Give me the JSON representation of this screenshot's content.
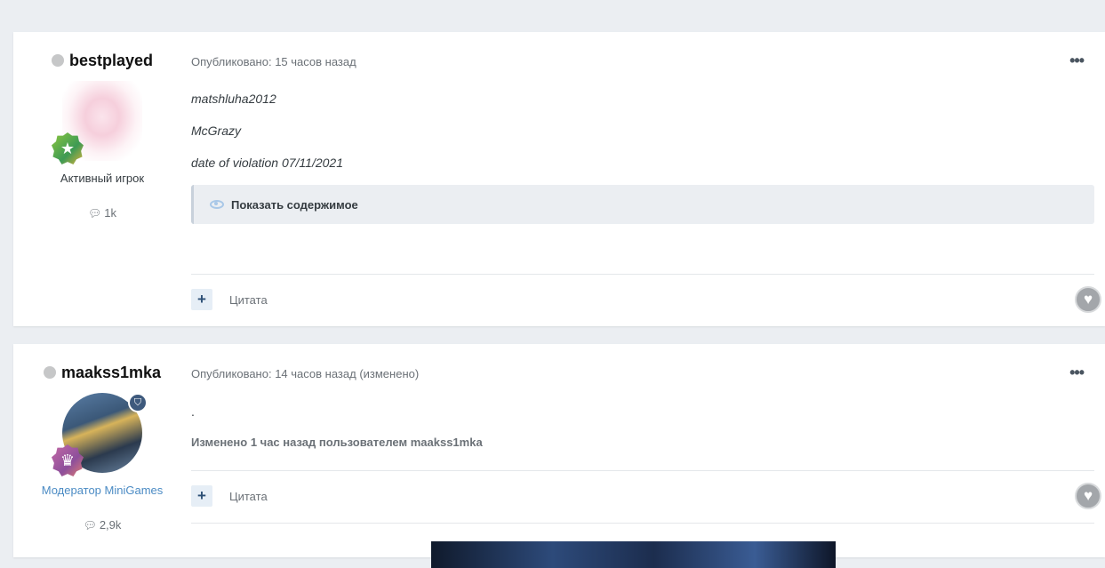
{
  "posts": [
    {
      "author": "bestplayed",
      "group": "Активный игрок",
      "post_count": "1k",
      "meta": "Опубликовано: 15 часов назад",
      "lines": [
        "matshluha2012",
        "McGrazy",
        "date of violation 07/11/2021"
      ],
      "spoiler_label": "Показать содержимое",
      "quote_label": "Цитата"
    },
    {
      "author": "maakss1mka",
      "group": "Модератор MiniGames",
      "post_count": "2,9k",
      "meta": "Опубликовано: 14 часов назад (изменено)",
      "body": ".",
      "edited": "Изменено 1 час назад пользователем maakss1mka",
      "quote_label": "Цитата"
    }
  ],
  "icons": {
    "status": "offline-dot-icon",
    "rank": "star-badge-icon",
    "rank2": "crown-badge-icon",
    "mod": "shield-icon",
    "posts": "speech-bubble-icon",
    "more": "ellipsis-icon",
    "spoiler": "eye-icon",
    "quote": "plus-icon",
    "reaction": "heart-icon"
  },
  "colors": {
    "page_bg": "#ebeef2",
    "moderator_group": "#4b8bc4",
    "meta_text": "#6b7177"
  }
}
